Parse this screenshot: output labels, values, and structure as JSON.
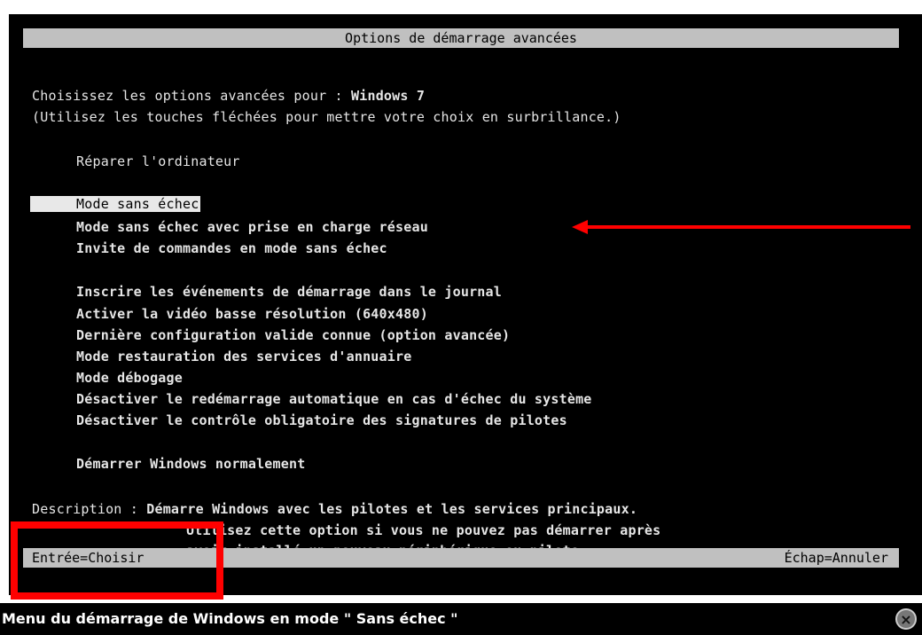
{
  "header": {
    "title": "Options de démarrage avancées"
  },
  "intro": {
    "line1_prefix": "Choisissez les options avancées pour : ",
    "line1_os": "Windows 7",
    "line2": "(Utilisez les touches fléchées pour mettre votre choix en surbrillance.)"
  },
  "options": {
    "repair": "Réparer l'ordinateur",
    "safe_mode": "Mode sans échec",
    "safe_mode_network": "Mode sans échec avec prise en charge réseau",
    "safe_mode_cmd": "Invite de commandes en mode sans échec",
    "boot_logging": "Inscrire les événements de démarrage dans le journal",
    "low_res_video": "Activer la vidéo basse résolution (640x480)",
    "last_known_good": "Dernière configuration valide connue (option avancée)",
    "ds_restore": "Mode restauration des services d'annuaire",
    "debug": "Mode débogage",
    "disable_auto_restart": "Désactiver le redémarrage automatique en cas d'échec du système",
    "disable_driver_sig": "Désactiver le contrôle obligatoire des signatures de pilotes",
    "start_normally": "Démarrer Windows normalement"
  },
  "description": {
    "label": "Description : ",
    "line1": "Démarre Windows avec les pilotes et les services principaux.",
    "line2": "Utilisez cette option si vous ne pouvez pas démarrer après",
    "line3": "avoir installé un nouveau périphérique ou pilote."
  },
  "footer": {
    "enter": "Entrée=Choisir",
    "escape": "Échap=Annuler"
  },
  "caption": "Menu du démarrage de Windows en mode \" Sans échec \"",
  "annotation_color": "#ff0000",
  "close_icon": "×"
}
